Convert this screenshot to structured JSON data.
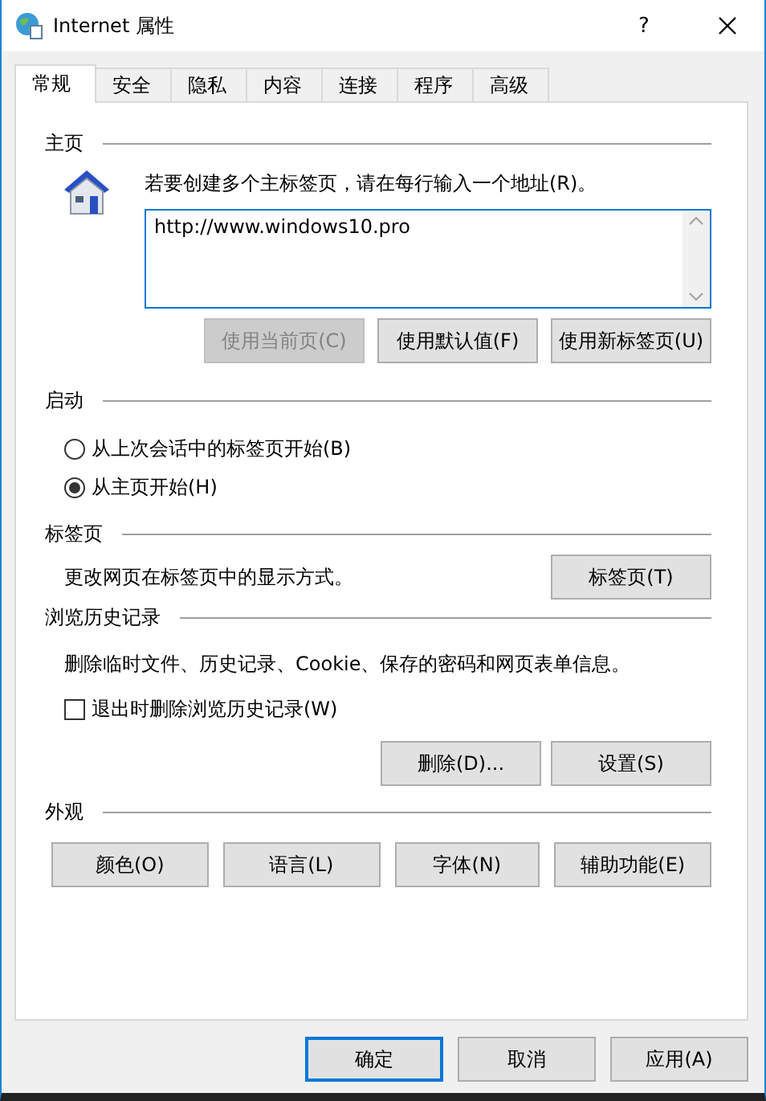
{
  "window": {
    "title": "Internet 属性",
    "help": "?"
  },
  "tabs": [
    {
      "label": "常规",
      "selected": true
    },
    {
      "label": "安全",
      "selected": false
    },
    {
      "label": "隐私",
      "selected": false
    },
    {
      "label": "内容",
      "selected": false
    },
    {
      "label": "连接",
      "selected": false
    },
    {
      "label": "程序",
      "selected": false
    },
    {
      "label": "高级",
      "selected": false
    }
  ],
  "home_page": {
    "heading": "主页",
    "instruction": "若要创建多个主标签页，请在每行输入一个地址(R)。",
    "addresses": "http://www.windows10.pro",
    "buttons": [
      {
        "label": "使用当前页(C)",
        "disabled": true
      },
      {
        "label": "使用默认值(F)",
        "disabled": false
      },
      {
        "label": "使用新标签页(U)",
        "disabled": false
      }
    ]
  },
  "startup": {
    "heading": "启动",
    "options": [
      {
        "label": "从上次会话中的标签页开始(B)",
        "selected": false
      },
      {
        "label": "从主页开始(H)",
        "selected": true
      }
    ]
  },
  "tabs_settings": {
    "heading": "标签页",
    "description": "更改网页在标签页中的显示方式。",
    "button": "标签页(T)"
  },
  "history": {
    "heading": "浏览历史记录",
    "description": "删除临时文件、历史记录、Cookie、保存的密码和网页表单信息。",
    "delete_on_exit": {
      "label": "退出时删除浏览历史记录(W)",
      "checked": false
    },
    "buttons": [
      "删除(D)...",
      "设置(S)"
    ]
  },
  "appearance": {
    "heading": "外观",
    "buttons": [
      "颜色(O)",
      "语言(L)",
      "字体(N)",
      "辅助功能(E)"
    ]
  },
  "footer_buttons": [
    {
      "label": "确定",
      "default": true
    },
    {
      "label": "取消",
      "default": false
    },
    {
      "label": "应用(A)",
      "default": false
    }
  ]
}
